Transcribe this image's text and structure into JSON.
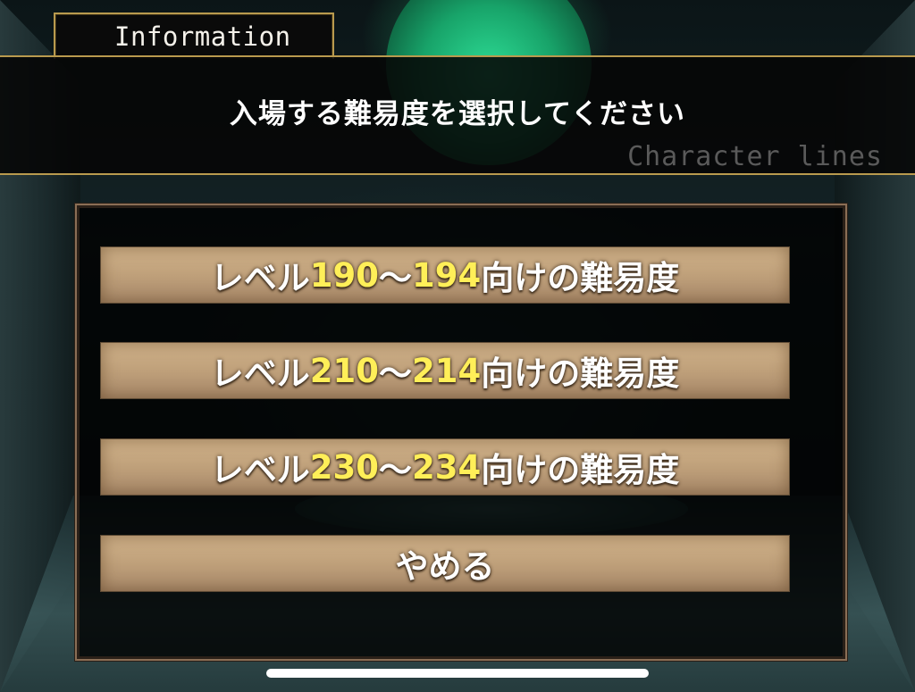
{
  "header": {
    "tab_title": "Information",
    "message": "入場する難易度を選択してください",
    "caption": "Character lines"
  },
  "options": [
    {
      "prefix": "レベル",
      "range_start": "190",
      "sep": "〜",
      "range_end": "194",
      "suffix": "向けの難易度"
    },
    {
      "prefix": "レベル",
      "range_start": "210",
      "sep": "〜",
      "range_end": "214",
      "suffix": "向けの難易度"
    },
    {
      "prefix": "レベル",
      "range_start": "230",
      "sep": "〜",
      "range_end": "234",
      "suffix": "向けの難易度"
    }
  ],
  "cancel_label": "やめる",
  "colors": {
    "gold_frame": "#b99a4e",
    "button_parchment": "#c9ab84",
    "level_number": "#ffef58",
    "text_white": "#ffffff"
  }
}
